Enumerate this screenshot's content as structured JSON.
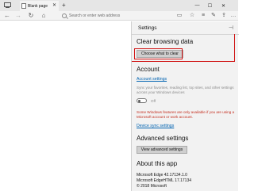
{
  "browser": {
    "tab": {
      "title": "Blank page"
    },
    "address": {
      "placeholder": "Search or enter web address"
    }
  },
  "settings": {
    "header": "Settings",
    "clear_browsing": {
      "title": "Clear browsing data",
      "button_label": "Choose what to clear"
    },
    "account": {
      "title": "Account",
      "settings_link": "Account settings",
      "sync_description": "Sync your favorites, reading list, top sites, and other settings across your Windows devices",
      "toggle_label": "Off",
      "warning": "Some Windows features are only available if you are using a Microsoft account or work account.",
      "device_sync_link": "Device sync settings"
    },
    "advanced": {
      "title": "Advanced settings",
      "button_label": "View advanced settings"
    },
    "about": {
      "title": "About this app",
      "version": "Microsoft Edge 42.17134.1.0",
      "html_version": "Microsoft EdgeHTML 17.17134",
      "copyright": "© 2018 Microsoft"
    }
  },
  "colors": {
    "accent_link": "#0063b1",
    "warning": "#c42b1c",
    "highlight": "#d01010",
    "panel_bg": "#f2f2f2"
  }
}
